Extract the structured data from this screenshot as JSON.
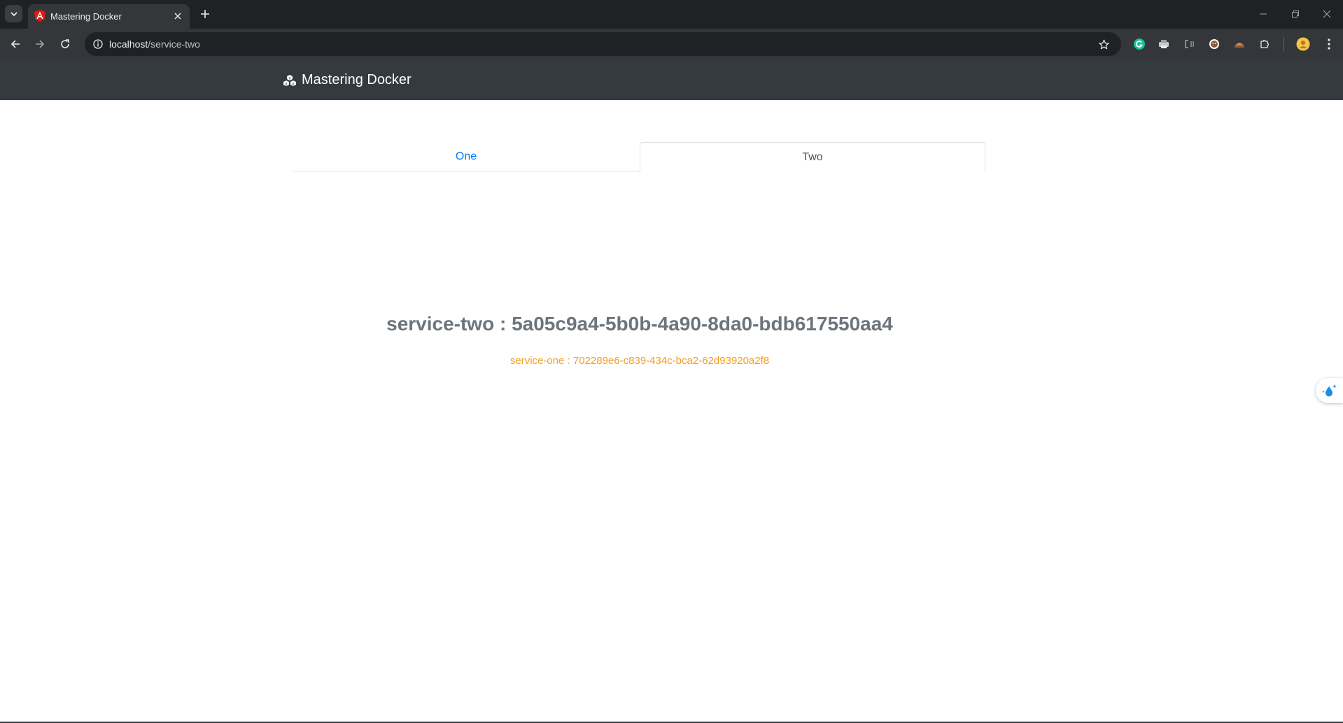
{
  "browser": {
    "tab_title": "Mastering Docker",
    "url_host": "localhost",
    "url_path": "/service-two",
    "icons": [
      "tab-search-icon",
      "angular-favicon-icon",
      "close-icon",
      "plus-icon",
      "minimize-icon",
      "restore-icon",
      "close-window-icon",
      "back-arrow-icon",
      "forward-arrow-icon",
      "reload-icon",
      "site-info-icon",
      "star-icon",
      "extension-icons",
      "puzzle-icon",
      "avatar",
      "more-vert-icon"
    ]
  },
  "navbar": {
    "brand": "Mastering Docker",
    "brand_icon": "cubes-icon"
  },
  "tabs": [
    {
      "label": "One",
      "active": false
    },
    {
      "label": "Two",
      "active": true
    }
  ],
  "content": {
    "main": "service-two : 5a05c9a4-5b0b-4a90-8da0-bdb617550aa4",
    "sub": "service-one : 702289e6-c839-434c-bca2-62d93920a2f8"
  },
  "colors": {
    "navbar_bg": "#343a40",
    "link_blue": "#007bff",
    "sub_orange": "#f0a020",
    "main_gray": "#6c757d"
  }
}
